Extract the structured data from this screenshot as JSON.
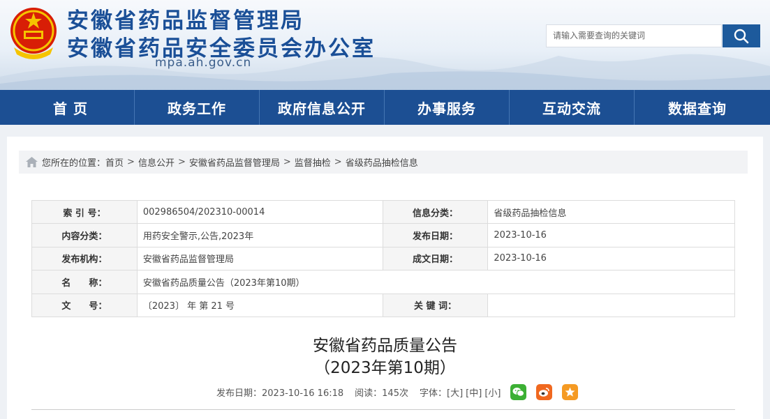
{
  "header": {
    "title_line1": "安徽省药品监督管理局",
    "title_line2": "安徽省药品安全委员会办公室",
    "domain": "mpa.ah.gov.cn",
    "search_placeholder": "请输入需要查询的关键词",
    "emblem_icon": "national-emblem-icon",
    "search_icon": "magnifier-icon"
  },
  "nav": {
    "items": [
      "首 页",
      "政务工作",
      "政府信息公开",
      "办事服务",
      "互动交流",
      "数据查询"
    ]
  },
  "breadcrumb": {
    "prefix": "您所在的位置：",
    "items": [
      "首页",
      "信息公开",
      "安徽省药品监督管理局",
      "监督抽检",
      "省级药品抽检信息"
    ],
    "separator": ">"
  },
  "info_table": {
    "index_label": "索 引 号：",
    "index_value": "002986504/202310-00014",
    "category_label": "信息分类：",
    "category_value": "省级药品抽检信息",
    "content_type_label": "内容分类：",
    "content_type_value": "用药安全警示,公告,2023年",
    "publish_date_label": "发布日期：",
    "publish_date_value": "2023-10-16",
    "agency_label": "发布机构：",
    "agency_value": "安徽省药品监督管理局",
    "created_date_label": "成文日期：",
    "created_date_value": "2023-10-16",
    "name_label": "名　　称：",
    "name_value": "安徽省药品质量公告（2023年第10期）",
    "doc_no_label": "文　　号：",
    "doc_no_value": "〔2023〕 年 第 21 号",
    "keywords_label": "关 键 词：",
    "keywords_value": ""
  },
  "article": {
    "title_line1": "安徽省药品质量公告",
    "title_line2": "（2023年第10期）",
    "meta_date": "发布日期：2023-10-16 16:18",
    "meta_views": "阅读：145次",
    "font_label": "字体：",
    "font_large": "[大]",
    "font_medium": "[中]",
    "font_small": "[小]",
    "share_icons": [
      "wechat-icon",
      "weibo-icon",
      "favorite-star-icon"
    ]
  },
  "colors": {
    "brand_blue": "#1c4f93",
    "title_blue": "#1a4f97",
    "wechat_green": "#3cb034",
    "weibo_orange": "#f0681f",
    "star_orange": "#f59a23"
  }
}
